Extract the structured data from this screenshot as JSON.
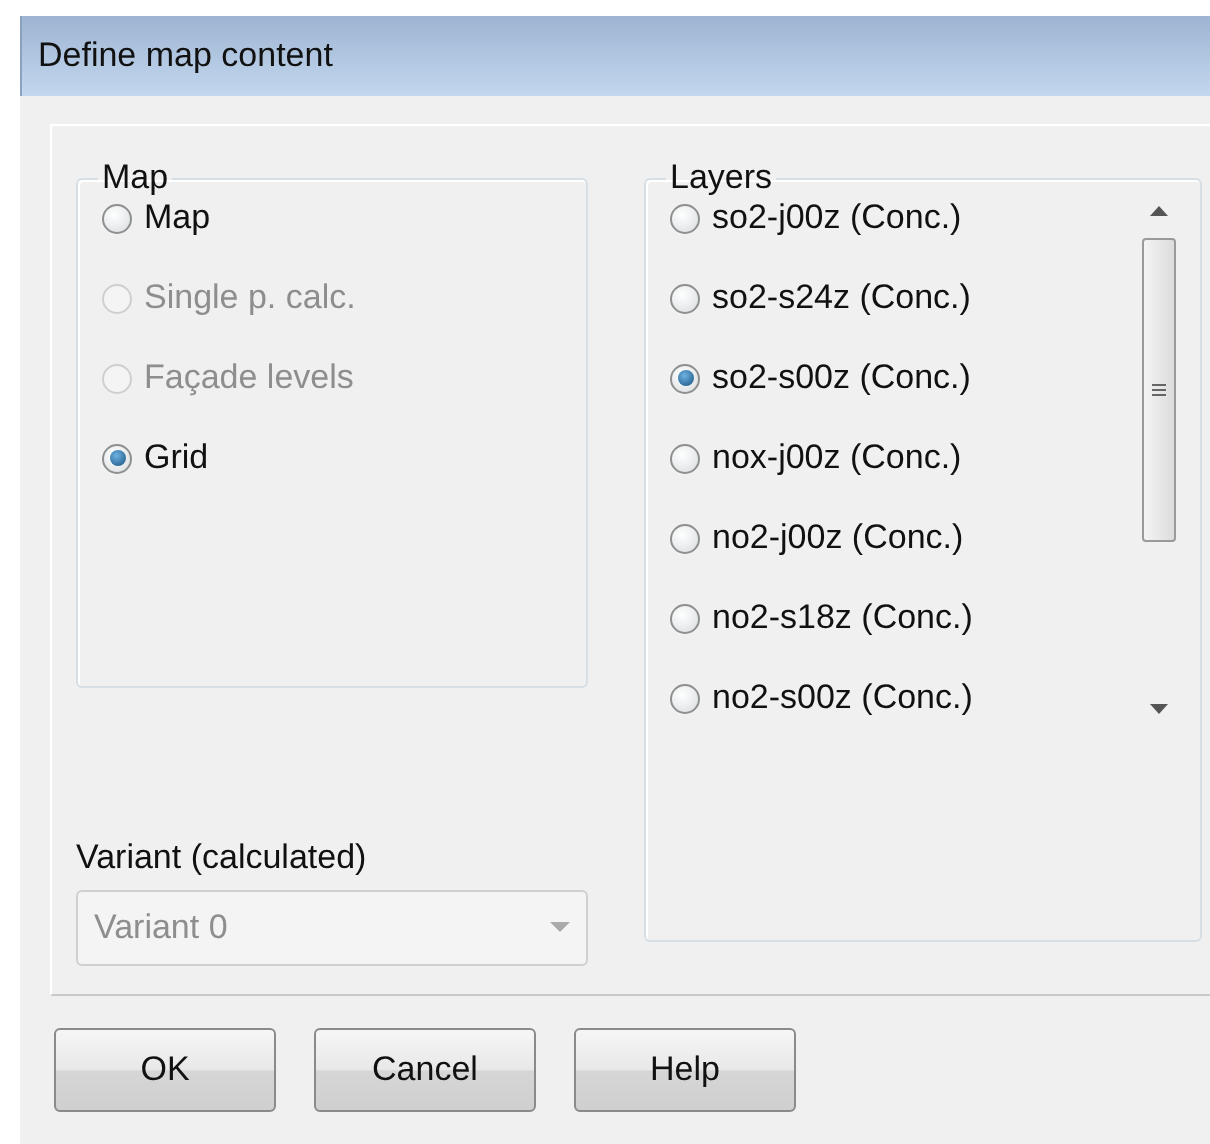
{
  "window": {
    "title": "Define map content"
  },
  "map_group": {
    "title": "Map",
    "options": [
      {
        "label": "Map",
        "selected": false,
        "disabled": false
      },
      {
        "label": "Single p. calc.",
        "selected": false,
        "disabled": true
      },
      {
        "label": "Façade levels",
        "selected": false,
        "disabled": true
      },
      {
        "label": "Grid",
        "selected": true,
        "disabled": false
      }
    ]
  },
  "layers_group": {
    "title": "Layers",
    "items": [
      {
        "label": "so2-j00z (Conc.)",
        "selected": false
      },
      {
        "label": "so2-s24z (Conc.)",
        "selected": false
      },
      {
        "label": "so2-s00z (Conc.)",
        "selected": true
      },
      {
        "label": "nox-j00z (Conc.)",
        "selected": false
      },
      {
        "label": "no2-j00z (Conc.)",
        "selected": false
      },
      {
        "label": "no2-s18z (Conc.)",
        "selected": false
      },
      {
        "label": "no2-s00z (Conc.)",
        "selected": false
      }
    ]
  },
  "variant": {
    "label": "Variant (calculated)",
    "value": "Variant 0",
    "disabled": true
  },
  "buttons": [
    "OK",
    "Cancel",
    "Help"
  ]
}
